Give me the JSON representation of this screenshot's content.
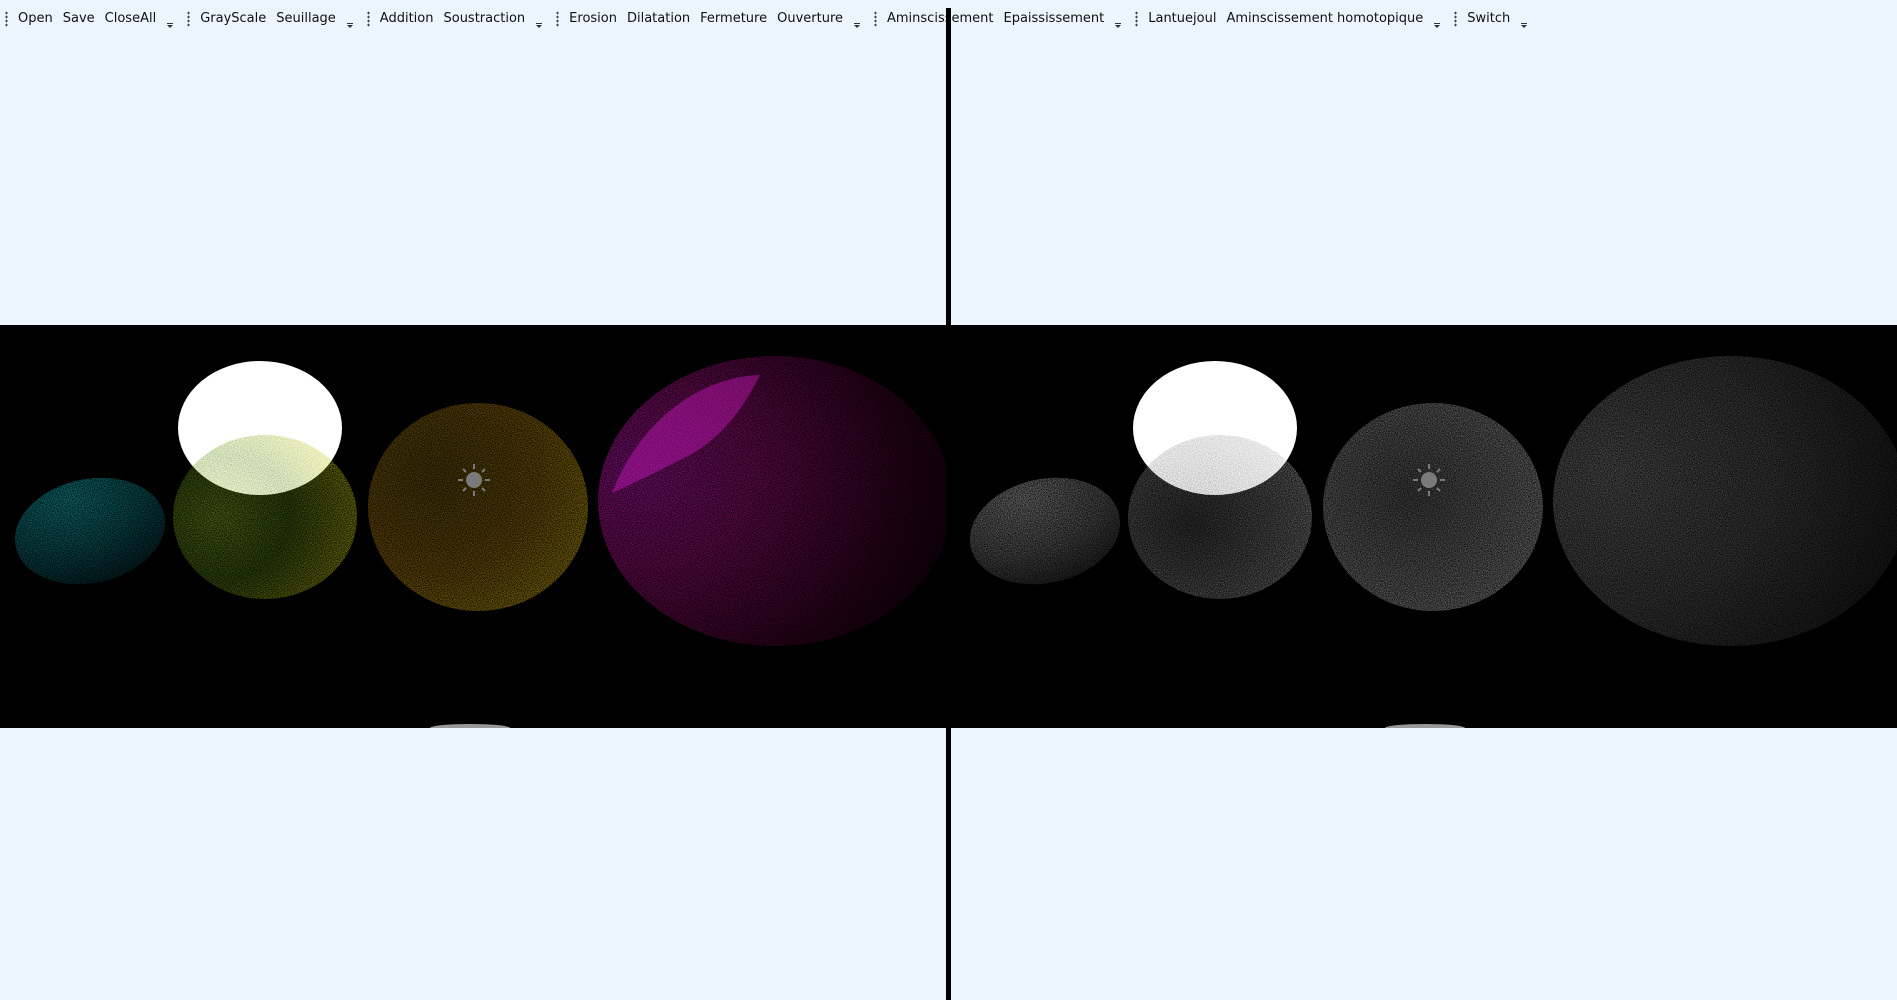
{
  "toolbar": {
    "groups": [
      {
        "items": [
          "Open",
          "Save",
          "CloseAll"
        ]
      },
      {
        "items": [
          "GrayScale",
          "Seuillage"
        ]
      },
      {
        "items": [
          "Addition",
          "Soustraction"
        ]
      },
      {
        "items": [
          "Erosion",
          "Dilatation",
          "Fermeture",
          "Ouverture"
        ]
      },
      {
        "items": [
          "Aminscissement",
          "Epaississement"
        ]
      },
      {
        "items": [
          "Lantuejoul",
          "Aminscissement homotopique"
        ]
      },
      {
        "items": [
          "Switch"
        ]
      }
    ]
  },
  "images": {
    "left": {
      "mode": "color"
    },
    "right": {
      "mode": "grayscale"
    }
  },
  "colors": {
    "background": "#ecf4fd",
    "canvas": "#000000",
    "cyan": "#19d6d6",
    "yellow": "#e6e619",
    "magenta": "#f01ee6",
    "orange": "#e8a616"
  }
}
